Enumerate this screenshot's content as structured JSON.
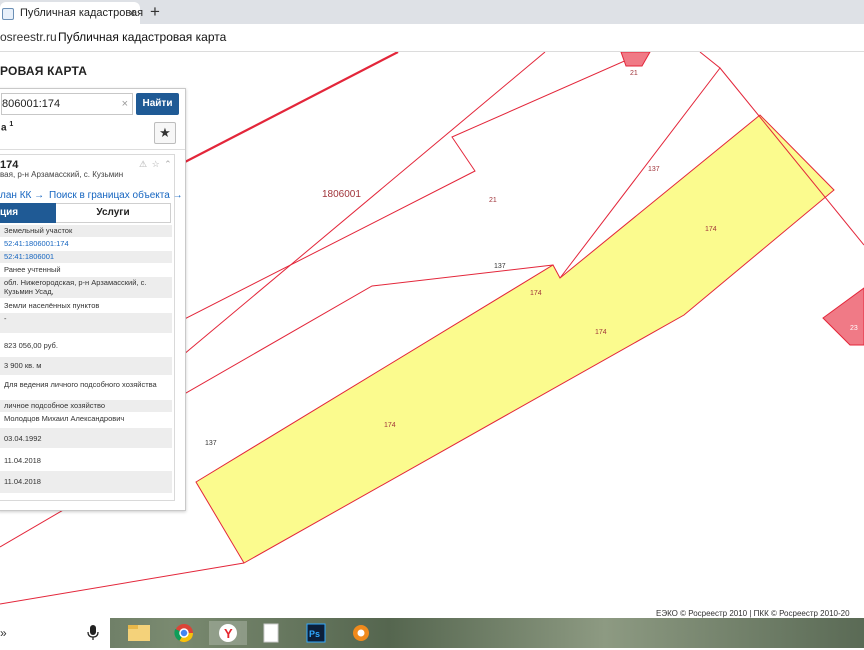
{
  "browser": {
    "tab_title": "Публичная кадастровая",
    "tab_close": "×",
    "new_tab": "+",
    "address_domain": "osreestr.ru",
    "page_title": "Публичная кадастровая карта"
  },
  "app": {
    "title": "РОВАЯ КАРТА"
  },
  "search": {
    "value": "806001:174",
    "clear": "×",
    "button": "Найти"
  },
  "result_header": {
    "label": "а",
    "sup": "1",
    "star": "★"
  },
  "object": {
    "number": "174",
    "address": "вая, р-н Арзамасский, с. Кузьмин",
    "icons": "⚠ ☆ ⌃",
    "link_plan": "лан КК →",
    "link_search": "Поиск в границах объекта →",
    "tab_active": "ция",
    "tab_services": "Услуги",
    "rows": [
      "Земельный участок",
      "52:41:1806001:174",
      "52:41:1806001",
      "Ранее учтенный",
      "обл. Нижегородская, р-н Арзамасский, с. Кузьмин Усад,",
      "Земли населённых пунктов",
      "-",
      "823 056,00 руб.",
      "3 900 кв. м",
      "Для ведения личного подсобного хозяйства",
      "личное подсобное хозяйство",
      "Молодцов Михаил Александрович",
      "03.04.1992",
      "11.04.2018",
      "11.04.2018"
    ]
  },
  "map": {
    "labels": {
      "quarter": "1806001",
      "parcel_21_top": "21",
      "parcel_21": "21",
      "parcel_137_a": "137",
      "parcel_137_b": "137",
      "parcel_137_c": "137",
      "parcel_174_a": "174",
      "parcel_174_b": "174",
      "parcel_174_c": "174",
      "parcel_174_d": "174",
      "edge": "23"
    },
    "colors": {
      "boundary": "#e3263a",
      "selected_fill": "#fbfb8e",
      "neighbour_fill": "#f07a86",
      "label": "#a0343a"
    }
  },
  "footer": {
    "copyright": "ЕЭКО © Росреестр 2010 | ПКК © Росреестр 2010-20"
  },
  "taskbar": {
    "chevron": "»",
    "apps": [
      "file-explorer",
      "chrome",
      "yandex-browser",
      "notepad",
      "photoshop",
      "settings"
    ]
  }
}
